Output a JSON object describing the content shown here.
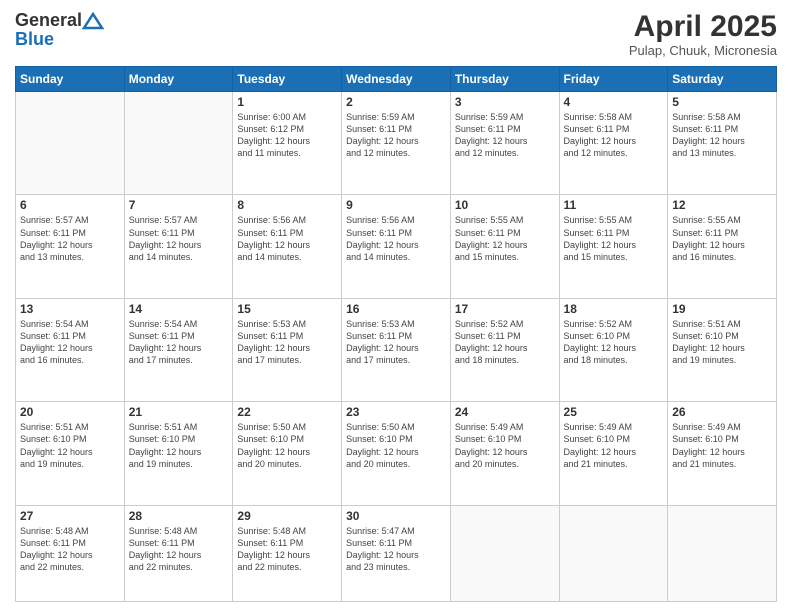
{
  "header": {
    "logo_line1": "General",
    "logo_line2": "Blue",
    "title": "April 2025",
    "location": "Pulap, Chuuk, Micronesia"
  },
  "weekdays": [
    "Sunday",
    "Monday",
    "Tuesday",
    "Wednesday",
    "Thursday",
    "Friday",
    "Saturday"
  ],
  "weeks": [
    [
      {
        "day": "",
        "info": ""
      },
      {
        "day": "",
        "info": ""
      },
      {
        "day": "1",
        "info": "Sunrise: 6:00 AM\nSunset: 6:12 PM\nDaylight: 12 hours\nand 11 minutes."
      },
      {
        "day": "2",
        "info": "Sunrise: 5:59 AM\nSunset: 6:11 PM\nDaylight: 12 hours\nand 12 minutes."
      },
      {
        "day": "3",
        "info": "Sunrise: 5:59 AM\nSunset: 6:11 PM\nDaylight: 12 hours\nand 12 minutes."
      },
      {
        "day": "4",
        "info": "Sunrise: 5:58 AM\nSunset: 6:11 PM\nDaylight: 12 hours\nand 12 minutes."
      },
      {
        "day": "5",
        "info": "Sunrise: 5:58 AM\nSunset: 6:11 PM\nDaylight: 12 hours\nand 13 minutes."
      }
    ],
    [
      {
        "day": "6",
        "info": "Sunrise: 5:57 AM\nSunset: 6:11 PM\nDaylight: 12 hours\nand 13 minutes."
      },
      {
        "day": "7",
        "info": "Sunrise: 5:57 AM\nSunset: 6:11 PM\nDaylight: 12 hours\nand 14 minutes."
      },
      {
        "day": "8",
        "info": "Sunrise: 5:56 AM\nSunset: 6:11 PM\nDaylight: 12 hours\nand 14 minutes."
      },
      {
        "day": "9",
        "info": "Sunrise: 5:56 AM\nSunset: 6:11 PM\nDaylight: 12 hours\nand 14 minutes."
      },
      {
        "day": "10",
        "info": "Sunrise: 5:55 AM\nSunset: 6:11 PM\nDaylight: 12 hours\nand 15 minutes."
      },
      {
        "day": "11",
        "info": "Sunrise: 5:55 AM\nSunset: 6:11 PM\nDaylight: 12 hours\nand 15 minutes."
      },
      {
        "day": "12",
        "info": "Sunrise: 5:55 AM\nSunset: 6:11 PM\nDaylight: 12 hours\nand 16 minutes."
      }
    ],
    [
      {
        "day": "13",
        "info": "Sunrise: 5:54 AM\nSunset: 6:11 PM\nDaylight: 12 hours\nand 16 minutes."
      },
      {
        "day": "14",
        "info": "Sunrise: 5:54 AM\nSunset: 6:11 PM\nDaylight: 12 hours\nand 17 minutes."
      },
      {
        "day": "15",
        "info": "Sunrise: 5:53 AM\nSunset: 6:11 PM\nDaylight: 12 hours\nand 17 minutes."
      },
      {
        "day": "16",
        "info": "Sunrise: 5:53 AM\nSunset: 6:11 PM\nDaylight: 12 hours\nand 17 minutes."
      },
      {
        "day": "17",
        "info": "Sunrise: 5:52 AM\nSunset: 6:11 PM\nDaylight: 12 hours\nand 18 minutes."
      },
      {
        "day": "18",
        "info": "Sunrise: 5:52 AM\nSunset: 6:10 PM\nDaylight: 12 hours\nand 18 minutes."
      },
      {
        "day": "19",
        "info": "Sunrise: 5:51 AM\nSunset: 6:10 PM\nDaylight: 12 hours\nand 19 minutes."
      }
    ],
    [
      {
        "day": "20",
        "info": "Sunrise: 5:51 AM\nSunset: 6:10 PM\nDaylight: 12 hours\nand 19 minutes."
      },
      {
        "day": "21",
        "info": "Sunrise: 5:51 AM\nSunset: 6:10 PM\nDaylight: 12 hours\nand 19 minutes."
      },
      {
        "day": "22",
        "info": "Sunrise: 5:50 AM\nSunset: 6:10 PM\nDaylight: 12 hours\nand 20 minutes."
      },
      {
        "day": "23",
        "info": "Sunrise: 5:50 AM\nSunset: 6:10 PM\nDaylight: 12 hours\nand 20 minutes."
      },
      {
        "day": "24",
        "info": "Sunrise: 5:49 AM\nSunset: 6:10 PM\nDaylight: 12 hours\nand 20 minutes."
      },
      {
        "day": "25",
        "info": "Sunrise: 5:49 AM\nSunset: 6:10 PM\nDaylight: 12 hours\nand 21 minutes."
      },
      {
        "day": "26",
        "info": "Sunrise: 5:49 AM\nSunset: 6:10 PM\nDaylight: 12 hours\nand 21 minutes."
      }
    ],
    [
      {
        "day": "27",
        "info": "Sunrise: 5:48 AM\nSunset: 6:11 PM\nDaylight: 12 hours\nand 22 minutes."
      },
      {
        "day": "28",
        "info": "Sunrise: 5:48 AM\nSunset: 6:11 PM\nDaylight: 12 hours\nand 22 minutes."
      },
      {
        "day": "29",
        "info": "Sunrise: 5:48 AM\nSunset: 6:11 PM\nDaylight: 12 hours\nand 22 minutes."
      },
      {
        "day": "30",
        "info": "Sunrise: 5:47 AM\nSunset: 6:11 PM\nDaylight: 12 hours\nand 23 minutes."
      },
      {
        "day": "",
        "info": ""
      },
      {
        "day": "",
        "info": ""
      },
      {
        "day": "",
        "info": ""
      }
    ]
  ]
}
